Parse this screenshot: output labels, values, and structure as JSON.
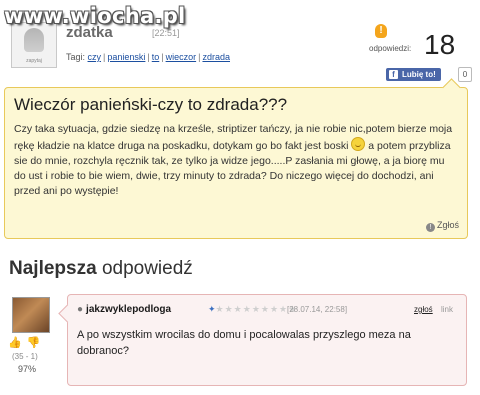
{
  "watermark": "www.wiocha.pl",
  "question": {
    "username": "zdatka",
    "timestamp": "[22:51]",
    "avatar_caption": "zapytaj",
    "tags_label": "Tagi:",
    "tags": [
      "czy",
      "panienski",
      "to",
      "wieczor",
      "zdrada"
    ],
    "answers_label": "odpowiedzi:",
    "answers_count": "18",
    "like_label": "Lubię to!",
    "like_count": "0",
    "title": "Wieczór panieński-czy to zdrada???",
    "body_part1": "Czy taka sytuacja, gdzie siedzę na krześle, striptizer tańczy, ja nie robie nic,potem bierze moja rękę kładzie na klatce druga na poskadku, dotykam go bo fakt jest boski",
    "body_part2": "a potem przyblizа sie do mnie, rozchyla ręcznik tak, ze tylko ja widze jego.....P zasłania mi głowę, a ja biorę mu do ust i robie to bie wiem, dwie, trzy minuty to zdrada? Do niczego więcej do dochodzi, ani przed ani po występie!",
    "report_label": "Zgłoś"
  },
  "best_answer": {
    "heading_bold": "Najlepsza",
    "heading_rest": "odpowiedź",
    "username": "jakzwyklepodloga",
    "timestamp": "[28.07.14, 22:58]",
    "report_label": "zgłoś",
    "link_label": "link",
    "body": "A po wszystkim wrocilas do domu i pocalowalas przyszlego meza na dobranoc?",
    "vote_stats": "(35 - 1)",
    "vote_percent": "97%"
  },
  "colors": {
    "question_bg": "#fdf8d4",
    "question_border": "#e8c95a",
    "answer_bg": "#fbf2f2",
    "answer_border": "#e6b5b5",
    "link": "#1c4fa0",
    "facebook": "#4a66a8"
  },
  "icons": {
    "bulb": "lightbulb-icon",
    "facebook": "facebook-icon",
    "smiley": "smiley-icon",
    "report": "report-icon",
    "thumbs_up": "thumbs-up-icon",
    "thumbs_down": "thumbs-down-icon"
  }
}
